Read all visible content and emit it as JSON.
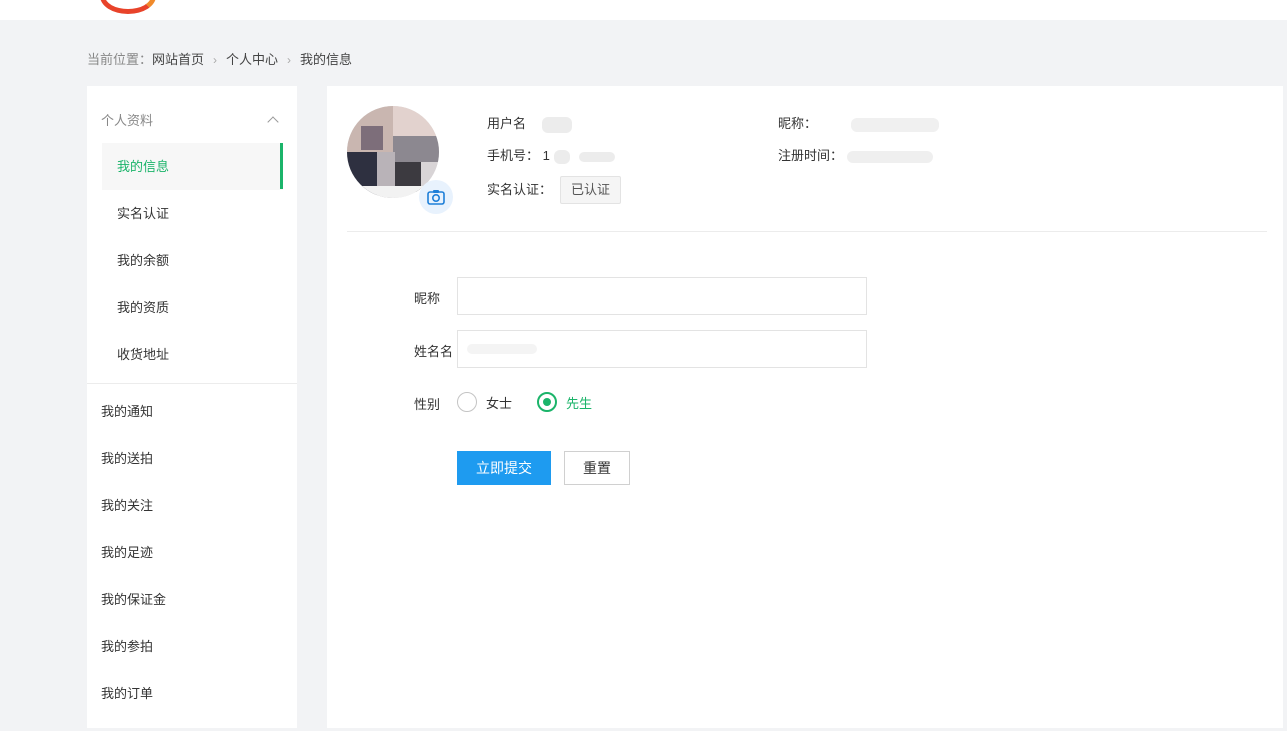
{
  "breadcrumb": {
    "prefix": "当前位置：",
    "items": [
      "网站首页",
      "个人中心",
      "我的信息"
    ]
  },
  "sidebar": {
    "group_title": "个人资料",
    "sub_items": [
      {
        "label": "我的信息",
        "active": true
      },
      {
        "label": "实名认证"
      },
      {
        "label": "我的余额"
      },
      {
        "label": "我的资质"
      },
      {
        "label": "收货地址"
      }
    ],
    "main_items": [
      {
        "label": "我的通知"
      },
      {
        "label": "我的送拍"
      },
      {
        "label": "我的关注"
      },
      {
        "label": "我的足迹"
      },
      {
        "label": "我的保证金"
      },
      {
        "label": "我的参拍"
      },
      {
        "label": "我的订单"
      }
    ]
  },
  "profile": {
    "username_label": "用户名",
    "phone_label": "手机号：",
    "phone_value": "1",
    "realname_label": "实名认证：",
    "realname_status": "已认证",
    "nickname_label": "昵称：",
    "regtime_label": "注册时间："
  },
  "form": {
    "nickname_label": "昵称",
    "nickname_value": "",
    "name_label": "姓名",
    "name_value": "名",
    "gender_label": "性别",
    "gender_options": [
      {
        "label": "女士",
        "checked": false
      },
      {
        "label": "先生",
        "checked": true
      }
    ],
    "submit_label": "立即提交",
    "reset_label": "重置"
  },
  "colors": {
    "accent_green": "#1bb46a",
    "primary_blue": "#1e9bf0"
  },
  "icons": {
    "camera": "camera-icon",
    "collapse": "chevron-up-icon",
    "breadcrumb_separator": "chevron-right-icon"
  }
}
